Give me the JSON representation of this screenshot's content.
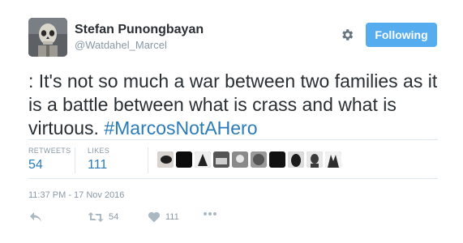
{
  "user": {
    "name": "Stefan Punongbayan",
    "handle": "@Watdahel_Marcel"
  },
  "follow_button": {
    "label": "Following"
  },
  "icons": {
    "settings": "gear-icon",
    "reply": "reply-icon",
    "retweet": "retweet-icon",
    "like": "heart-icon",
    "more": "more-dots-icon"
  },
  "tweet": {
    "text": ": It's not so much a war between two families as it is a battle between what is crass and what is virtuous. ",
    "hashtag": "#MarcosNotAHero"
  },
  "stats": {
    "retweets_label": "RETWEETS",
    "retweets_value": "54",
    "likes_label": "LIKES",
    "likes_value": "111"
  },
  "timestamp": "11:37 PM - 17 Nov 2016",
  "actions": {
    "retweet_count": "54",
    "like_count": "111"
  },
  "colors": {
    "accent": "#55acee",
    "link": "#2b7bb9",
    "muted": "#8899a6"
  }
}
